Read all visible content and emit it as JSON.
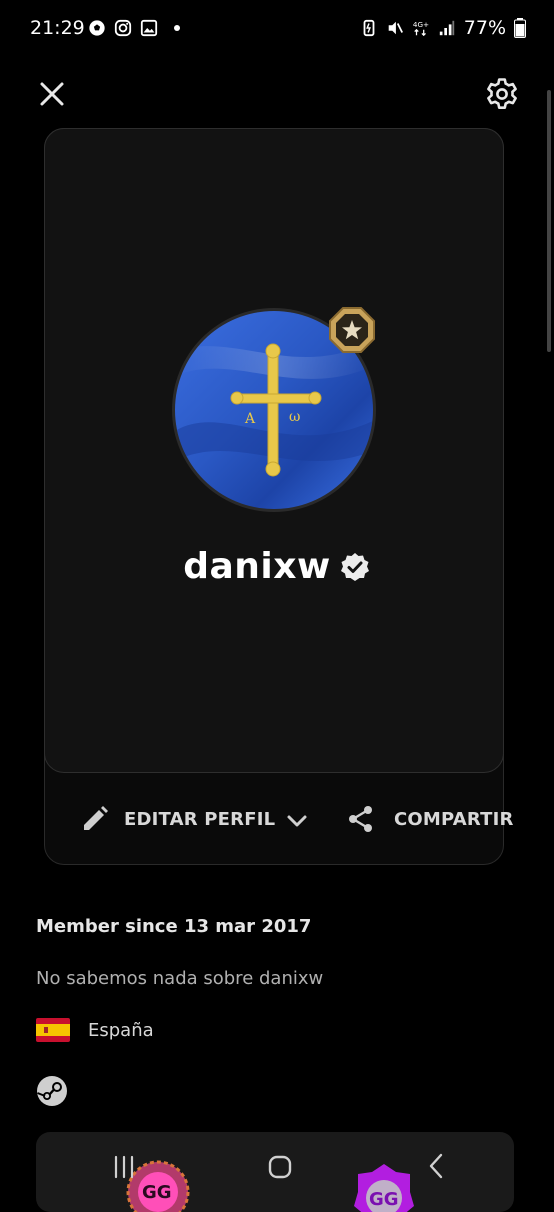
{
  "status_bar": {
    "time": "21:29",
    "battery": "77%",
    "network": "4G+",
    "left_icons": [
      "soccer-ball-icon",
      "instagram-icon",
      "gallery-icon",
      "notification-dot"
    ],
    "right_icons": [
      "battery-saver-icon",
      "mute-icon",
      "network-4g-icon",
      "signal-icon",
      "battery-icon"
    ]
  },
  "header": {
    "close_icon": "close-icon",
    "settings_icon": "gear-icon"
  },
  "profile": {
    "username": "danixw",
    "verified_icon": "verified-badge-icon",
    "rank_icon": "star-rank-badge-icon",
    "avatar": "asturias-flag-avatar",
    "avatar_colors": {
      "blue": "#2f5fd0",
      "cross": "#e8c84a"
    }
  },
  "actions": {
    "edit_label": "EDITAR PERFIL",
    "share_label": "COMPARTIR",
    "edit_icon": "pencil-icon",
    "dropdown_icon": "chevron-down-icon",
    "share_icon": "share-icon"
  },
  "details": {
    "member_since": "Member since 13 mar 2017",
    "about": "No sabemos nada sobre danixw",
    "country": "España",
    "country_flag_icon": "spain-flag-icon",
    "steam_icon": "steam-icon"
  },
  "nav_bar": {
    "icons": [
      "recent-apps-icon",
      "home-icon",
      "back-icon"
    ]
  }
}
